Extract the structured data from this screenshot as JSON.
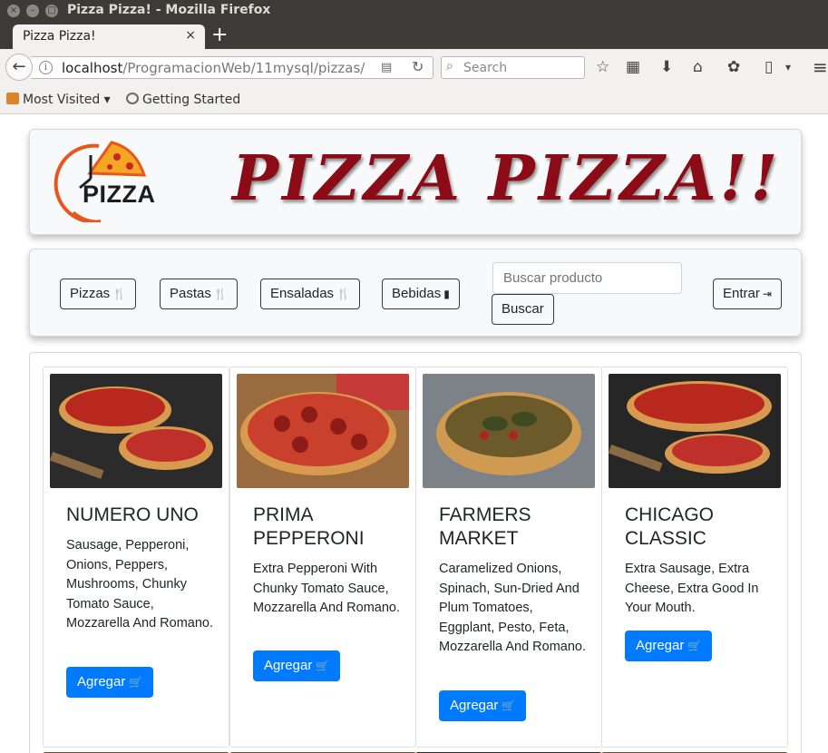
{
  "window": {
    "title": "Pizza Pizza! - Mozilla Firefox",
    "close_glyph": "×",
    "minimize_glyph": "–",
    "maximize_glyph": "□"
  },
  "tab": {
    "title": "Pizza Pizza!",
    "close_glyph": "×",
    "new_tab_glyph": "+"
  },
  "nav": {
    "back_glyph": "←",
    "url_host": "localhost",
    "url_path": "/ProgramacionWeb/11mysql/pizzas/",
    "info_glyph": "i",
    "reader_glyph": "▤",
    "reload_glyph": "↻",
    "search_placeholder": "Search",
    "search_glyph": "⌕",
    "star_glyph": "☆",
    "library_glyph": "▦",
    "download_glyph": "⬇",
    "home_glyph": "⌂",
    "ext_glyph": "✿",
    "clipboard_glyph": "▯",
    "dropdown_glyph": "▾",
    "menu_glyph": "≡"
  },
  "bookmarks": [
    {
      "label": "Most Visited ▾",
      "icon": "folder-icon"
    },
    {
      "label": "Getting Started",
      "icon": "globe-icon"
    }
  ],
  "header": {
    "logo_text": "PIZZA",
    "brand_title": "PIZZA  PIZZA!!"
  },
  "menu": {
    "buttons": [
      {
        "label": "Pizzas",
        "icon": "utensils-icon",
        "glyph": "🍴"
      },
      {
        "label": "Pastas",
        "icon": "utensils-icon",
        "glyph": "🍴"
      },
      {
        "label": "Ensaladas",
        "icon": "utensils-icon",
        "glyph": "🍴"
      },
      {
        "label": "Bebidas",
        "icon": "beer-icon",
        "glyph": "▮"
      }
    ],
    "search_placeholder": "Buscar producto",
    "search_button": "Buscar",
    "login_button": "Entrar",
    "login_glyph": "⇥"
  },
  "products": [
    {
      "name": "NUMERO UNO",
      "description": "Sausage, Pepperoni, Onions, Peppers, Mushrooms, Chunky Tomato Sauce, Mozzarella And Romano.",
      "button": "Agregar",
      "cart_glyph": "🛒"
    },
    {
      "name": "PRIMA PEPPERONI",
      "description": "Extra Pepperoni With Chunky Tomato Sauce, Mozzarella And Romano.",
      "button": "Agregar",
      "cart_glyph": "🛒"
    },
    {
      "name": "FARMERS MARKET",
      "description": "Caramelized Onions, Spinach, Sun-Dried And Plum Tomatoes, Eggplant, Pesto, Feta, Mozzarella And Romano.",
      "button": "Agregar",
      "cart_glyph": "🛒"
    },
    {
      "name": "CHICAGO CLASSIC",
      "description": "Extra Sausage, Extra Cheese, Extra Good In Your Mouth.",
      "button": "Agregar",
      "cart_glyph": "🛒"
    }
  ],
  "colors": {
    "brand_red": "#8b0c17",
    "primary_blue": "#007bff",
    "titlebar": "#3c3b37",
    "toolbar": "#f2f1f0"
  }
}
